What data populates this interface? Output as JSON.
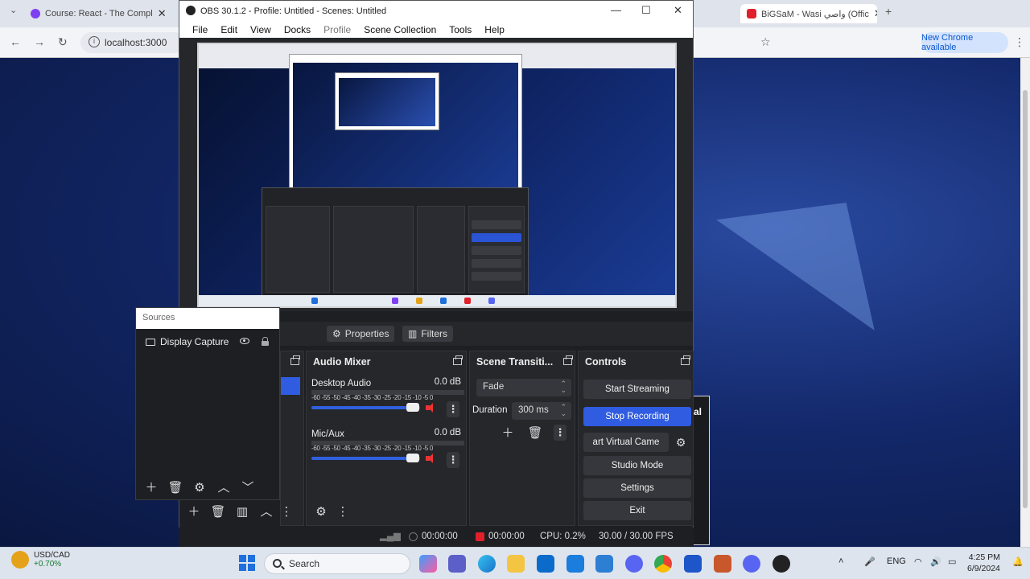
{
  "browser": {
    "tabs": [
      {
        "title": "Course: React - The Compl",
        "favicon_color": "#7e3ff2"
      },
      {
        "title": "BiGSaM - Wasi واصي (Offic",
        "favicon_color": "#e0202b"
      }
    ],
    "address": "localhost:3000",
    "new_chrome_label": "New Chrome available"
  },
  "obs": {
    "window_title": "OBS 30.1.2 - Profile: Untitled - Scenes: Untitled",
    "menu": [
      "File",
      "Edit",
      "View",
      "Docks",
      "Profile",
      "Scene Collection",
      "Tools",
      "Help"
    ],
    "sources": {
      "title": "Sources",
      "items": [
        {
          "name": "Display Capture"
        }
      ]
    },
    "props_bar": {
      "properties_label": "Properties",
      "filters_label": "Filters"
    },
    "audio_mixer": {
      "title": "Audio Mixer",
      "channels": [
        {
          "name": "Desktop Audio",
          "level": "0.0 dB",
          "ticks": "-60 -55 -50 -45 -40 -35 -30 -25 -20 -15 -10 -5 0"
        },
        {
          "name": "Mic/Aux",
          "level": "0.0 dB",
          "ticks": "-60 -55 -50 -45 -40 -35 -30 -25 -20 -15 -10 -5 0"
        }
      ]
    },
    "scene_transitions": {
      "title": "Scene Transiti...",
      "transition": "Fade",
      "duration_label": "Duration",
      "duration_value": "300 ms"
    },
    "controls": {
      "title": "Controls",
      "start_streaming": "Start Streaming",
      "stop_recording": "Stop Recording",
      "virtual_camera": "art Virtual Came",
      "studio_mode": "Studio Mode",
      "settings": "Settings",
      "exit": "Exit"
    },
    "status": {
      "stream_time": "00:00:00",
      "rec_time": "00:00:00",
      "cpu": "CPU: 0.2%",
      "fps": "30.00 / 30.00 FPS"
    },
    "side_panel_text": "al"
  },
  "taskbar": {
    "ticker_name": "USD/CAD",
    "ticker_change": "+0.70%",
    "search_placeholder": "Search",
    "lang": "ENG",
    "time": "4:25 PM",
    "date": "6/9/2024"
  }
}
